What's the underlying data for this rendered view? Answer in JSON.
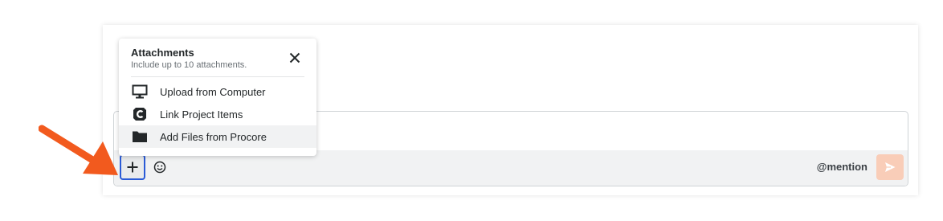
{
  "popover": {
    "title": "Attachments",
    "subtitle": "Include up to 10 attachments.",
    "close_icon": "close-icon",
    "items": [
      {
        "label": "Upload from Computer",
        "icon": "monitor-icon"
      },
      {
        "label": "Link Project Items",
        "icon": "procore-logo-icon"
      },
      {
        "label": "Add Files from Procore",
        "icon": "folder-icon"
      }
    ]
  },
  "toolbar": {
    "add_icon": "plus-icon",
    "emoji_icon": "smiley-icon",
    "mention_label": "@mention",
    "send_icon": "send-icon"
  },
  "colors": {
    "accent_border": "#2a5bd7",
    "send_disabled": "#f9cdb8",
    "arrow": "#f25a1e"
  }
}
